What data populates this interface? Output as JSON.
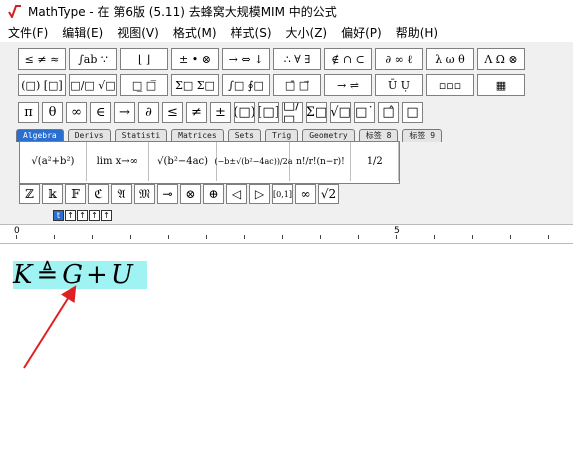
{
  "window": {
    "title": "MathType - 在 第6版 (5.11) 去蜂窝大规模MIM 中的公式",
    "accent": "#2a6fd0"
  },
  "menu": [
    "文件(F)",
    "编辑(E)",
    "视图(V)",
    "格式(M)",
    "样式(S)",
    "大小(Z)",
    "偏好(P)",
    "帮助(H)"
  ],
  "palette_row1": [
    "≤ ≠ ≈",
    "∫ab ∵",
    "⌊ ⌋",
    "± • ⊗",
    "→ ⇔ ↓",
    "∴ ∀ ∃",
    "∉ ∩ ⊂",
    "∂ ∞ ℓ",
    "λ ω θ",
    "Λ Ω ⊗"
  ],
  "palette_row2": [
    "(□) [□]",
    "□/□ √□",
    "□̲ □̅",
    "Σ□ Σ□",
    "∫□ ∮□",
    "□̄ □⃗",
    "→ ⇌",
    "Ū Ụ",
    "▫▫▫",
    "▦"
  ],
  "symbols_row": [
    "π",
    "θ",
    "∞",
    "∈",
    "→",
    "∂",
    "≤",
    "≠",
    "±",
    "(□)",
    "[□]",
    "□/□",
    "Σ□",
    "√□",
    "□˙",
    "□̂",
    "□"
  ],
  "tabs": [
    "Algebra",
    "Derivs",
    "Statisti",
    "Matrices",
    "Sets",
    "Trig",
    "Geometry",
    "标签 8",
    "标签 9"
  ],
  "templates": [
    "√(a²+b²)",
    "lim x→∞",
    "√(b²−4ac)",
    "(−b±√(b²−4ac))/2a",
    "n!/r!(n−r)!",
    "1/2"
  ],
  "bottom_symbols": [
    "ℤ",
    "𝕜",
    "𝔽",
    "ℭ",
    "𝔄",
    "𝔐",
    "⊸",
    "⊗",
    "⊕",
    "◁",
    "▷",
    "[0,1]",
    "∞",
    "√2"
  ],
  "size_buttons": [
    "t",
    "↑",
    "↑",
    "↑",
    "↑"
  ],
  "ruler": {
    "mark0": "0",
    "mark5": "5"
  },
  "formula": {
    "K": "K",
    "eq": "≜",
    "G": "G",
    "plus": "+",
    "U": "U"
  }
}
